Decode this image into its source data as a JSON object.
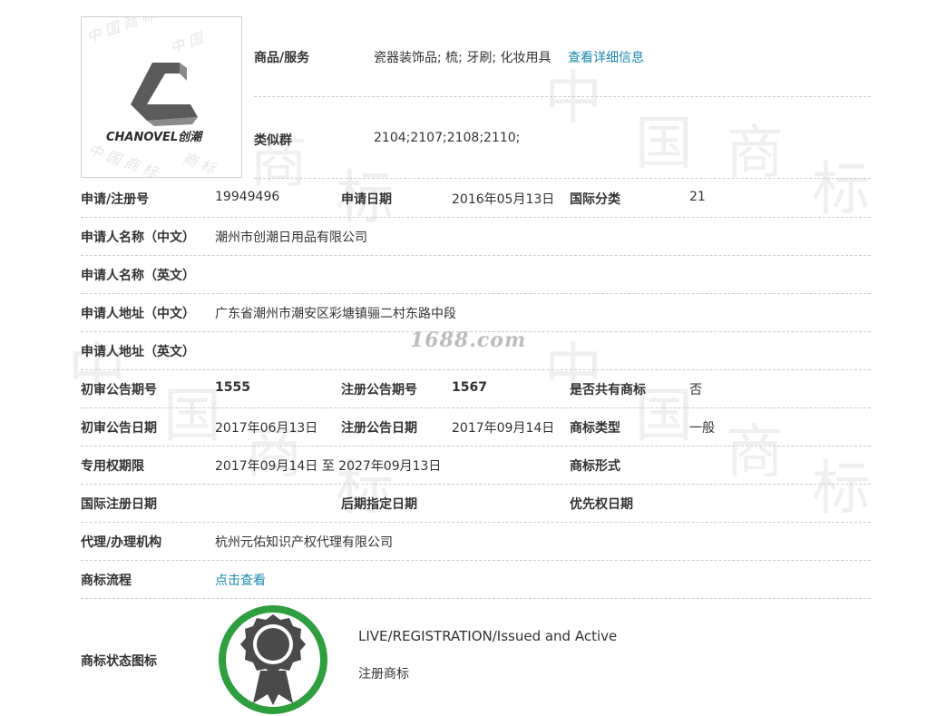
{
  "logo": {
    "brand_text": "CHANOVEL创潮",
    "watermark_text": "中国商标"
  },
  "top": {
    "goods_label": "商品/服务",
    "goods_value": "瓷器装饰品; 梳; 牙刷; 化妆用具",
    "goods_link": "查看详细信息",
    "similar_label": "类似群",
    "similar_value": "2104;2107;2108;2110;"
  },
  "rows": {
    "reg_no_label": "申请/注册号",
    "reg_no_value": "19949496",
    "apply_date_label": "申请日期",
    "apply_date_value": "2016年05月13日",
    "intl_class_label": "国际分类",
    "intl_class_value": "21",
    "applicant_cn_label": "申请人名称（中文）",
    "applicant_cn_value": "潮州市创潮日用品有限公司",
    "applicant_en_label": "申请人名称（英文）",
    "address_cn_label": "申请人地址（中文）",
    "address_cn_value": "广东省潮州市潮安区彩塘镇骊二村东路中段",
    "address_en_label": "申请人地址（英文）",
    "prelim_no_label": "初审公告期号",
    "prelim_no_value": "1555",
    "reg_notice_no_label": "注册公告期号",
    "reg_notice_no_value": "1567",
    "shared_label": "是否共有商标",
    "shared_value": "否",
    "prelim_date_label": "初审公告日期",
    "prelim_date_value": "2017年06月13日",
    "reg_notice_date_label": "注册公告日期",
    "reg_notice_date_value": "2017年09月14日",
    "tm_type_label": "商标类型",
    "tm_type_value": "一般",
    "term_label": "专用权期限",
    "term_value": "2017年09月14日 至 2027年09月13日",
    "tm_form_label": "商标形式",
    "intl_reg_date_label": "国际注册日期",
    "later_date_label": "后期指定日期",
    "priority_date_label": "优先权日期",
    "agent_label": "代理/办理机构",
    "agent_value": "杭州元佑知识产权代理有限公司",
    "process_label": "商标流程",
    "process_link": "点击查看",
    "status_icon_label": "商标状态图标",
    "status_en": "LIVE/REGISTRATION/Issued and Active",
    "status_cn": "注册商标"
  },
  "overlay": {
    "site_watermark": "1688.com"
  },
  "colors": {
    "link": "#1a88b0",
    "badge_ring": "#2e9e3e",
    "badge_fill": "#4a4a4a",
    "separator": "#cccccc"
  }
}
